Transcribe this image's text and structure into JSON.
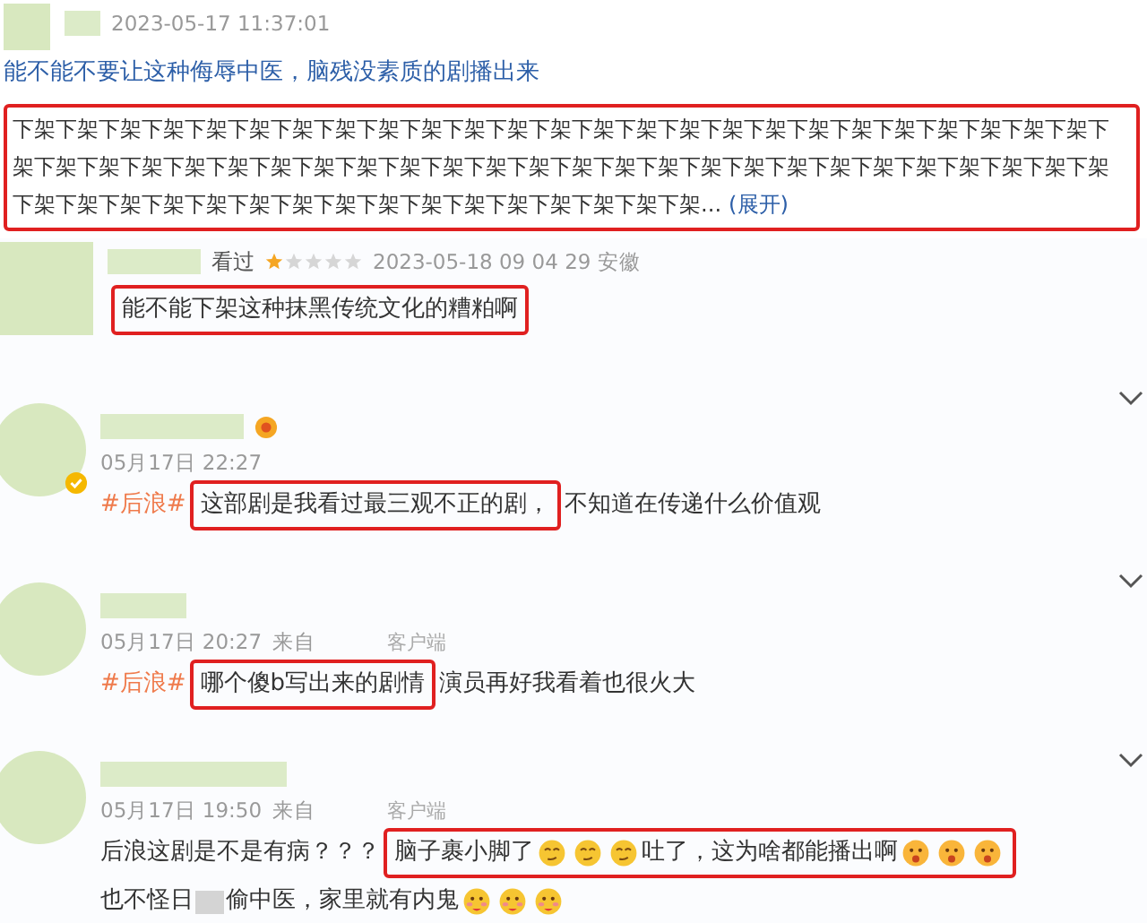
{
  "comments": [
    {
      "verified": false,
      "badge": false,
      "menu": false,
      "meta": [
        {
          "kind": "time",
          "text": "2023-05-17 11:37:01"
        }
      ],
      "lines": [
        [
          {
            "kind": "blue",
            "text": "能不能不要让这种侮辱中医，脑残没素质的剧播出来"
          }
        ],
        [
          {
            "kind": "panel",
            "children": [
              {
                "kind": "plain",
                "text": "下架下架下架下架下架下架下架下架下架下架下架下架下架下架下架下架下架下架下架下架下架下架下架下架下架下"
              },
              {
                "kind": "plain",
                "text": "架下架下架下架下架下架下架下架下架下架下架下架下架下架下架下架下架下架下架下架下架下架下架下架下架下架"
              },
              {
                "kind": "plain",
                "text": "下架下架下架下架下架下架下架下架下架下架下架下架下架下架下架下架..."
              },
              {
                "kind": "more",
                "text": "(展开)"
              }
            ]
          }
        ]
      ]
    },
    {
      "verified": false,
      "badge": false,
      "menu": false,
      "meta": [
        {
          "kind": "label",
          "text": "看过"
        },
        {
          "kind": "stars",
          "stars": 1
        },
        {
          "kind": "time",
          "text": "2023-05-18 09 04 29 安徽"
        }
      ],
      "lines": [
        [
          {
            "kind": "box",
            "children": [
              {
                "kind": "plain",
                "text": "能不能下架这种抹黑传统文化的糟粕啊"
              }
            ]
          }
        ]
      ]
    },
    {
      "verified": true,
      "badge": true,
      "menu": true,
      "meta": [
        {
          "kind": "time",
          "text": "05月17日 22:27"
        }
      ],
      "lines": [
        [
          {
            "kind": "tag",
            "text": "#后浪#"
          },
          {
            "kind": "box",
            "children": [
              {
                "kind": "plain",
                "text": "这部剧是我看过最三观不正的剧，"
              }
            ]
          },
          {
            "kind": "plain",
            "text": "不知道在传递什么价值观"
          }
        ]
      ]
    },
    {
      "verified": false,
      "badge": false,
      "menu": true,
      "meta": [
        {
          "kind": "time",
          "text": "05月17日 20:27"
        },
        {
          "kind": "time",
          "text": "来自"
        },
        {
          "kind": "source",
          "text": "客户端"
        }
      ],
      "lines": [
        [
          {
            "kind": "tag",
            "text": "#后浪#"
          },
          {
            "kind": "box",
            "children": [
              {
                "kind": "plain",
                "text": "哪个傻b写出来的剧情"
              }
            ]
          },
          {
            "kind": "plain",
            "text": "演员再好我看着也很火大"
          }
        ]
      ]
    },
    {
      "verified": false,
      "badge": false,
      "menu": true,
      "meta": [
        {
          "kind": "time",
          "text": "05月17日 19:50"
        },
        {
          "kind": "time",
          "text": "来自"
        },
        {
          "kind": "source",
          "text": "客户端"
        }
      ],
      "lines": [
        [
          {
            "kind": "plain",
            "text": "后浪这剧是不是有病？？？"
          },
          {
            "kind": "box",
            "children": [
              {
                "kind": "plain",
                "text": "脑子裹小脚了"
              },
              {
                "kind": "smirk"
              },
              {
                "kind": "smirk"
              },
              {
                "kind": "smirk"
              },
              {
                "kind": "plain",
                "text": "吐了，这为啥都能播出啊"
              },
              {
                "kind": "gasp"
              },
              {
                "kind": "gasp"
              },
              {
                "kind": "gasp"
              }
            ]
          }
        ],
        [
          {
            "kind": "plain",
            "text": "也不怪日"
          },
          {
            "kind": "blur"
          },
          {
            "kind": "plain",
            "text": "偷中医，家里就有内鬼"
          },
          {
            "kind": "blush"
          },
          {
            "kind": "blush"
          },
          {
            "kind": "blush"
          }
        ]
      ]
    }
  ]
}
